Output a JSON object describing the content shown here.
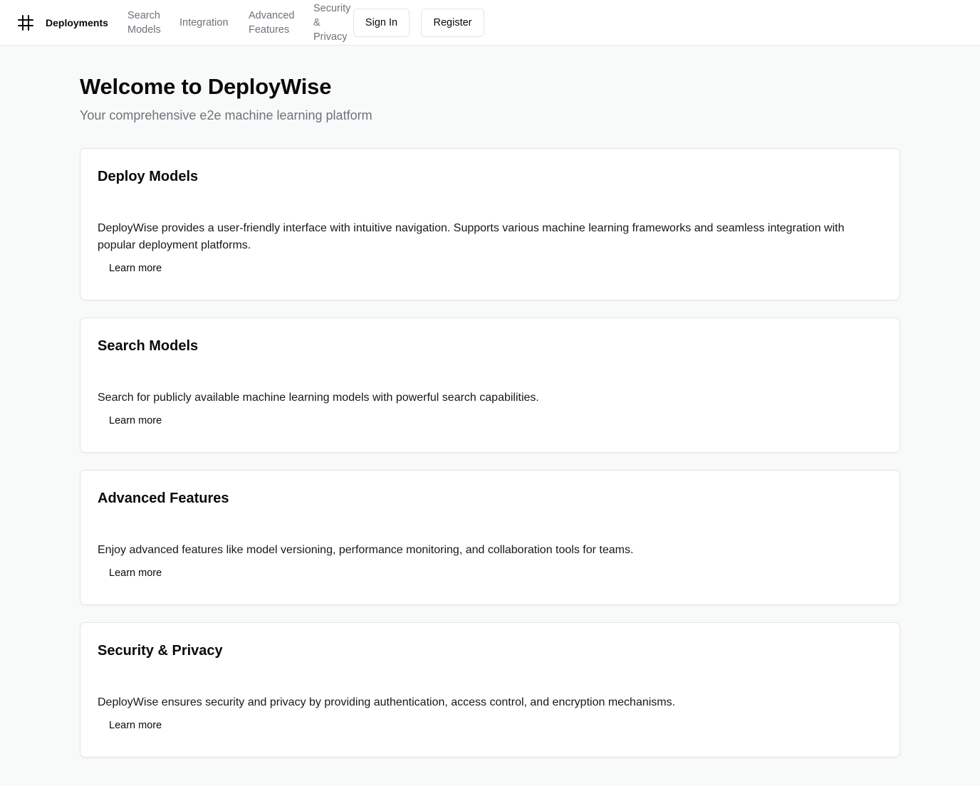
{
  "header": {
    "logo_icon": "hash-grid-icon",
    "brand": "Deployments",
    "nav": [
      {
        "label": "Search\nModels"
      },
      {
        "label": "Integration"
      },
      {
        "label": "Advanced\nFeatures"
      },
      {
        "label": "Security\n&\nPrivacy"
      }
    ],
    "sign_in_label": "Sign In",
    "register_label": "Register"
  },
  "main": {
    "title": "Welcome to DeployWise",
    "subtitle": "Your comprehensive e2e machine learning platform",
    "cards": [
      {
        "title": "Deploy Models",
        "text": "DeployWise provides a user-friendly interface with intuitive navigation. Supports various machine learning frameworks and seamless integration with popular deployment platforms.",
        "link_label": "Learn more"
      },
      {
        "title": "Search Models",
        "text": "Search for publicly available machine learning models with powerful search capabilities.",
        "link_label": "Learn more"
      },
      {
        "title": "Advanced Features",
        "text": "Enjoy advanced features like model versioning, performance monitoring, and collaboration tools for teams.",
        "link_label": "Learn more"
      },
      {
        "title": "Security & Privacy",
        "text": "DeployWise ensures security and privacy by providing authentication, access control, and encryption mechanisms.",
        "link_label": "Learn more"
      }
    ]
  },
  "colors": {
    "page_bg": "#f8f9f9",
    "header_bg": "#ffffff",
    "text_primary": "#0a0a0a",
    "text_muted": "#71717a",
    "border": "#e4e4e7"
  }
}
